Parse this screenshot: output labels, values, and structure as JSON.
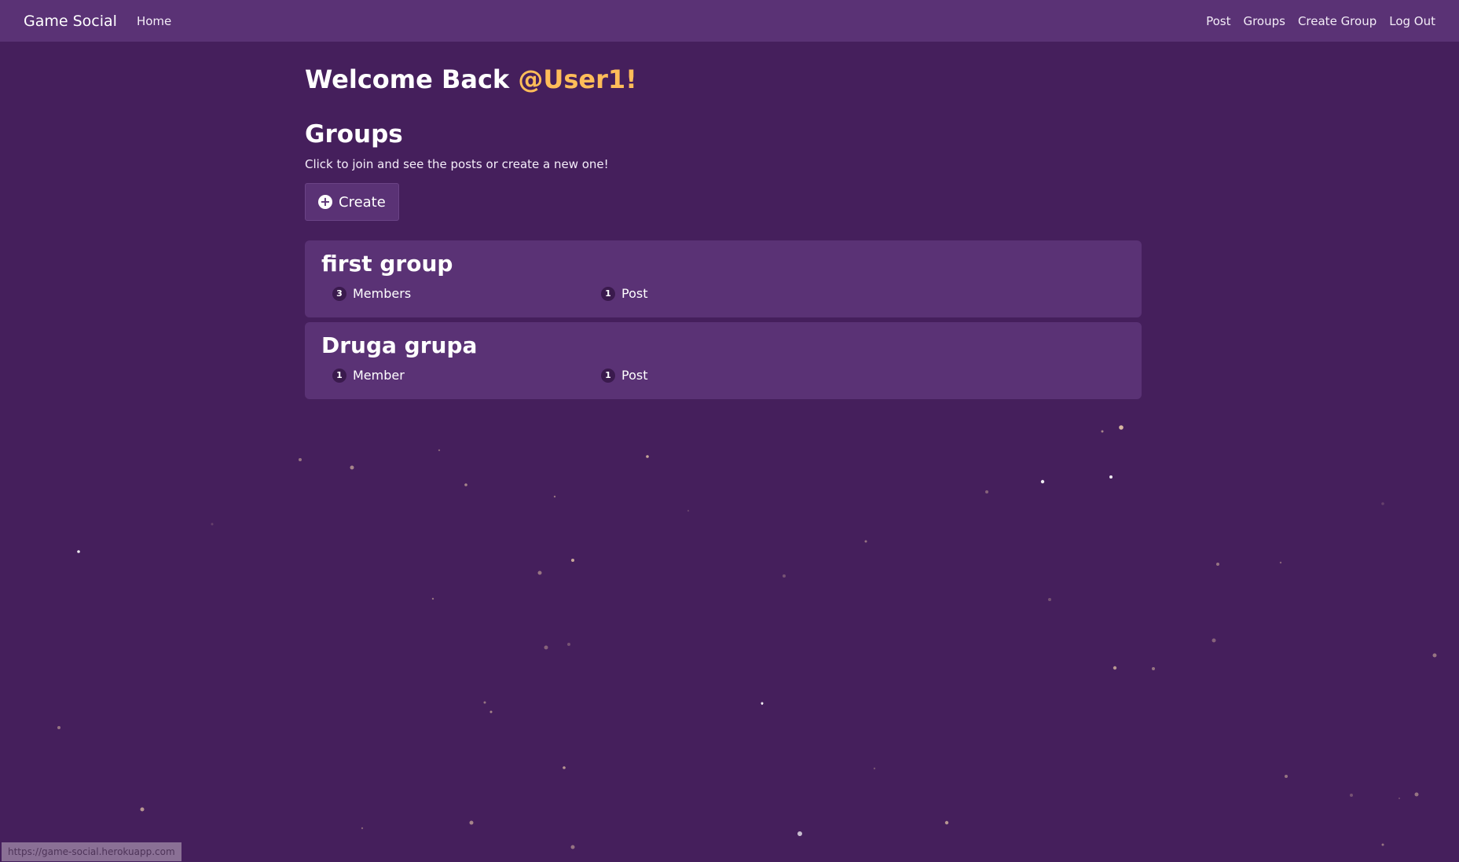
{
  "navbar": {
    "brand": "Game Social",
    "home": "Home",
    "right_links": [
      "Post",
      "Groups",
      "Create Group",
      "Log Out"
    ]
  },
  "welcome": {
    "prefix": "Welcome Back ",
    "username": "@User1!"
  },
  "groups_section": {
    "title": "Groups",
    "subtitle": "Click to join and see the posts or create a new one!",
    "create_label": "Create"
  },
  "groups": [
    {
      "name": "first group",
      "members_count": "3",
      "members_label": "Members",
      "posts_count": "1",
      "posts_label": "Post"
    },
    {
      "name": "Druga grupa",
      "members_count": "1",
      "members_label": "Member",
      "posts_count": "1",
      "posts_label": "Post"
    }
  ],
  "status_bar": {
    "url": "https://game-social.herokuapp.com"
  },
  "colors": {
    "background": "#451f5c",
    "navbar": "#5a3275",
    "card": "#5a3275",
    "accent": "#ffbd59"
  },
  "icons": {
    "create": "plus-circle-icon"
  }
}
